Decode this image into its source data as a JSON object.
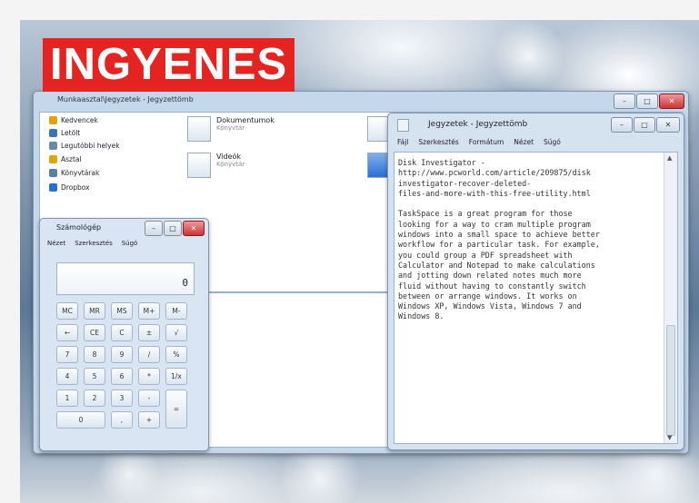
{
  "badge": {
    "text": "INGYENES",
    "color": "#e52421"
  },
  "explorer": {
    "title": "Munkaasztal\\Jegyzetek - Jegyzettömb",
    "nav": [
      {
        "label": "Kedvencek",
        "icon": "star-icon",
        "color": "#e0a300"
      },
      {
        "label": "Letölt",
        "icon": "folder-icon",
        "color": "#3f73b8"
      },
      {
        "label": "Legutóbbi helyek",
        "icon": "recent-icon",
        "color": "#6a88aa"
      },
      {
        "label": "Asztal",
        "icon": "desktop-icon",
        "color": "#e0a300"
      },
      {
        "label": "Könyvtárak",
        "icon": "library-icon",
        "color": "#5a7fa8"
      },
      {
        "label": "Dropbox",
        "icon": "dropbox-icon",
        "color": "#2a6fd6"
      }
    ],
    "files": [
      {
        "name": "Dokumentumok",
        "sub": "Könyvtár"
      },
      {
        "name": "Videók",
        "sub": "Könyvtár"
      }
    ]
  },
  "calculator": {
    "title": "Számológép",
    "menu": [
      "Nézet",
      "Szerkesztés",
      "Súgó"
    ],
    "display": "0",
    "keys": [
      "MC",
      "MR",
      "MS",
      "M+",
      "M-",
      "←",
      "CE",
      "C",
      "±",
      "√",
      "7",
      "8",
      "9",
      "/",
      "%",
      "4",
      "5",
      "6",
      "*",
      "1/x",
      "1",
      "2",
      "3",
      "-",
      "=",
      "0",
      ",",
      "+"
    ]
  },
  "notepad": {
    "title": "Jegyzetek - Jegyzettömb",
    "menu": [
      "Fájl",
      "Szerkesztés",
      "Formátum",
      "Nézet",
      "Súgó"
    ],
    "text": "Disk Investigator -\nhttp://www.pcworld.com/article/209875/disk\ninvestigator-recover-deleted-\nfiles-and-more-with-this-free-utility.html\n\nTaskSpace is a great program for those\nlooking for a way to cram multiple program\nwindows into a small space to achieve better\nworkflow for a particular task. For example,\nyou could group a PDF spreadsheet with\nCalculator and Notepad to make calculations\nand jotting down related notes much more\nfluid without having to constantly switch\nbetween or arrange windows. It works on\nWindows XP, Windows Vista, Windows 7 and\nWindows 8."
  }
}
